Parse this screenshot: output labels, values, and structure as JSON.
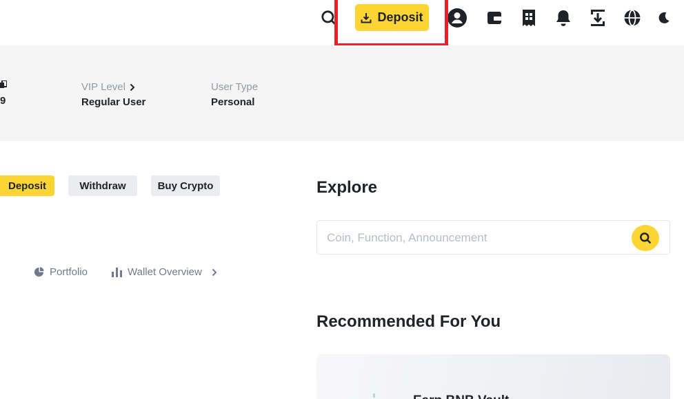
{
  "header": {
    "deposit_label": "Deposit",
    "icons": [
      "search-icon",
      "download-icon",
      "user-profile-icon",
      "wallet-icon",
      "orders-icon",
      "notification-bell-icon",
      "download-app-icon",
      "globe-language-icon",
      "moon-theme-icon"
    ]
  },
  "account": {
    "uid_tail": "9",
    "vip_label": "VIP Level",
    "vip_value": "Regular User",
    "user_type_label": "User Type",
    "user_type_value": "Personal"
  },
  "actions": {
    "deposit": "Deposit",
    "withdraw": "Withdraw",
    "buy_crypto": "Buy Crypto"
  },
  "links": {
    "portfolio": "Portfolio",
    "wallet_overview": "Wallet Overview"
  },
  "explore": {
    "title": "Explore",
    "search_placeholder": "Coin, Function, Announcement"
  },
  "recommended": {
    "title": "Recommended For You",
    "card_title": "Earn BNB Vault"
  },
  "colors": {
    "brand_yellow": "#fcd535",
    "highlight_red": "#e8202a",
    "text_primary": "#1e2329",
    "text_secondary": "#707a8a"
  }
}
